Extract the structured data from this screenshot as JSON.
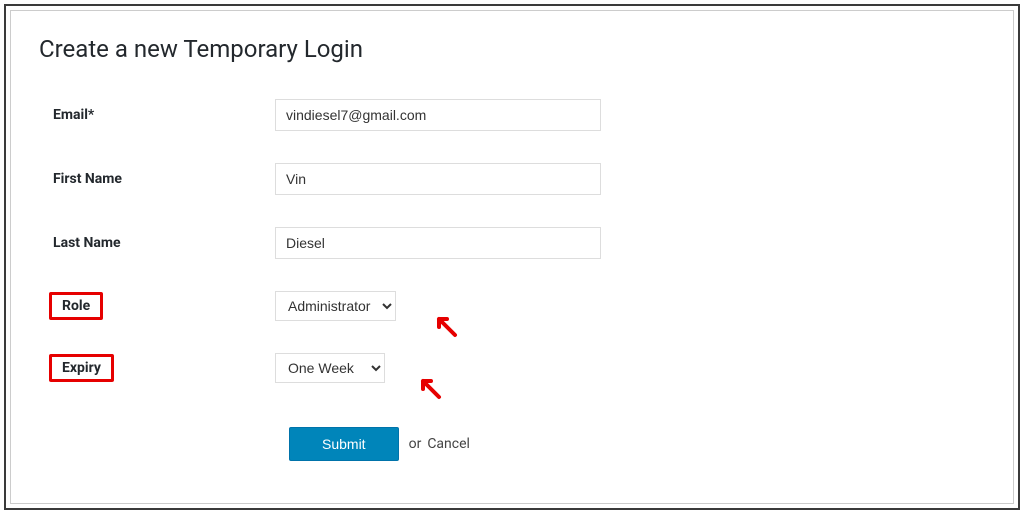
{
  "title": "Create a new Temporary Login",
  "form": {
    "email": {
      "label": "Email*",
      "value": "vindiesel7@gmail.com"
    },
    "firstName": {
      "label": "First Name",
      "value": "Vin"
    },
    "lastName": {
      "label": "Last Name",
      "value": "Diesel"
    },
    "role": {
      "label": "Role",
      "selected": "Administrator"
    },
    "expiry": {
      "label": "Expiry",
      "selected": "One Week"
    }
  },
  "buttons": {
    "submit": "Submit",
    "or": "or",
    "cancel": "Cancel"
  }
}
